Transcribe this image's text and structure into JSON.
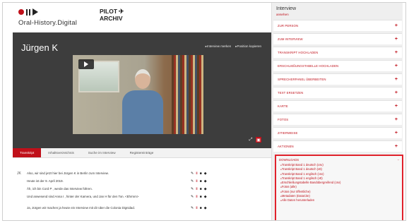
{
  "brand": {
    "logo_text": "Oral-History.Digital",
    "pilot_line1": "PILOT",
    "pilot_line2": "ARCHIV"
  },
  "interview": {
    "person_name": "Jürgen K",
    "stage_links": [
      "Interview merken",
      "Position kopieren"
    ],
    "icons": [
      "play-icon",
      "share-icon",
      "pdf-icon"
    ]
  },
  "tabs": [
    {
      "label": "Transkript",
      "active": true
    },
    {
      "label": "Inhaltsverzeichnis",
      "active": false
    },
    {
      "label": "Suche im Interview",
      "active": false
    },
    {
      "label": "Registereinträge",
      "active": false
    }
  ],
  "transcript": {
    "speaker_mark": "JK",
    "rows": [
      "Also, wir sind jetzt hier bei Jürgen K          in Berlin zum Interview.",
      "Heute ist der 9. April 2019.",
      "Äh, ich bin Cord P              , werde das Interview führen.",
      "Und anwesend sind Anna I          , hinter der Kamera, und Jan H          für den Ton. <Ehrmm>",
      "Ja, Jürgen wir machen ja heute ein Interview mit dir über die Colonia Dignidad."
    ]
  },
  "sidebar": {
    "title": "Interview",
    "subtitle": "ansehen",
    "close_label": "×",
    "sections": [
      "ZUR PERSON",
      "ZUM INTERVIEW",
      "TRANSKRIPT HOCHLADEN",
      "ERSCHLIEßUNGSTABELLE HOCHLADEN",
      "SPRECHERPANEL ÜBERBEITEN",
      "TEXT ERSETZEN",
      "KARTE",
      "FOTOS",
      "ZITIERWEISE",
      "AKTIONEN"
    ],
    "downloads": {
      "heading": "DOWNLOADS",
      "items": [
        "Transkript Band 1 deutsch (csv)",
        "Transkript Band 1 deutsch (vtt)",
        "Transkript Band 1 englisch (csv)",
        "Transkript Band 1 englisch (vtt)",
        "Erschließungstabelle Bandübergreifend (csv)",
        "Fotos (alle)",
        "Fotos (nur öffentliche)",
        "Metadaten (DataCite)",
        "Alle Daten herunterladen"
      ]
    }
  },
  "colors": {
    "accent": "#c0101a",
    "stage_bg": "#3d3d3d",
    "sidebar_bg": "#efefef",
    "download_border": "#e0222c"
  }
}
